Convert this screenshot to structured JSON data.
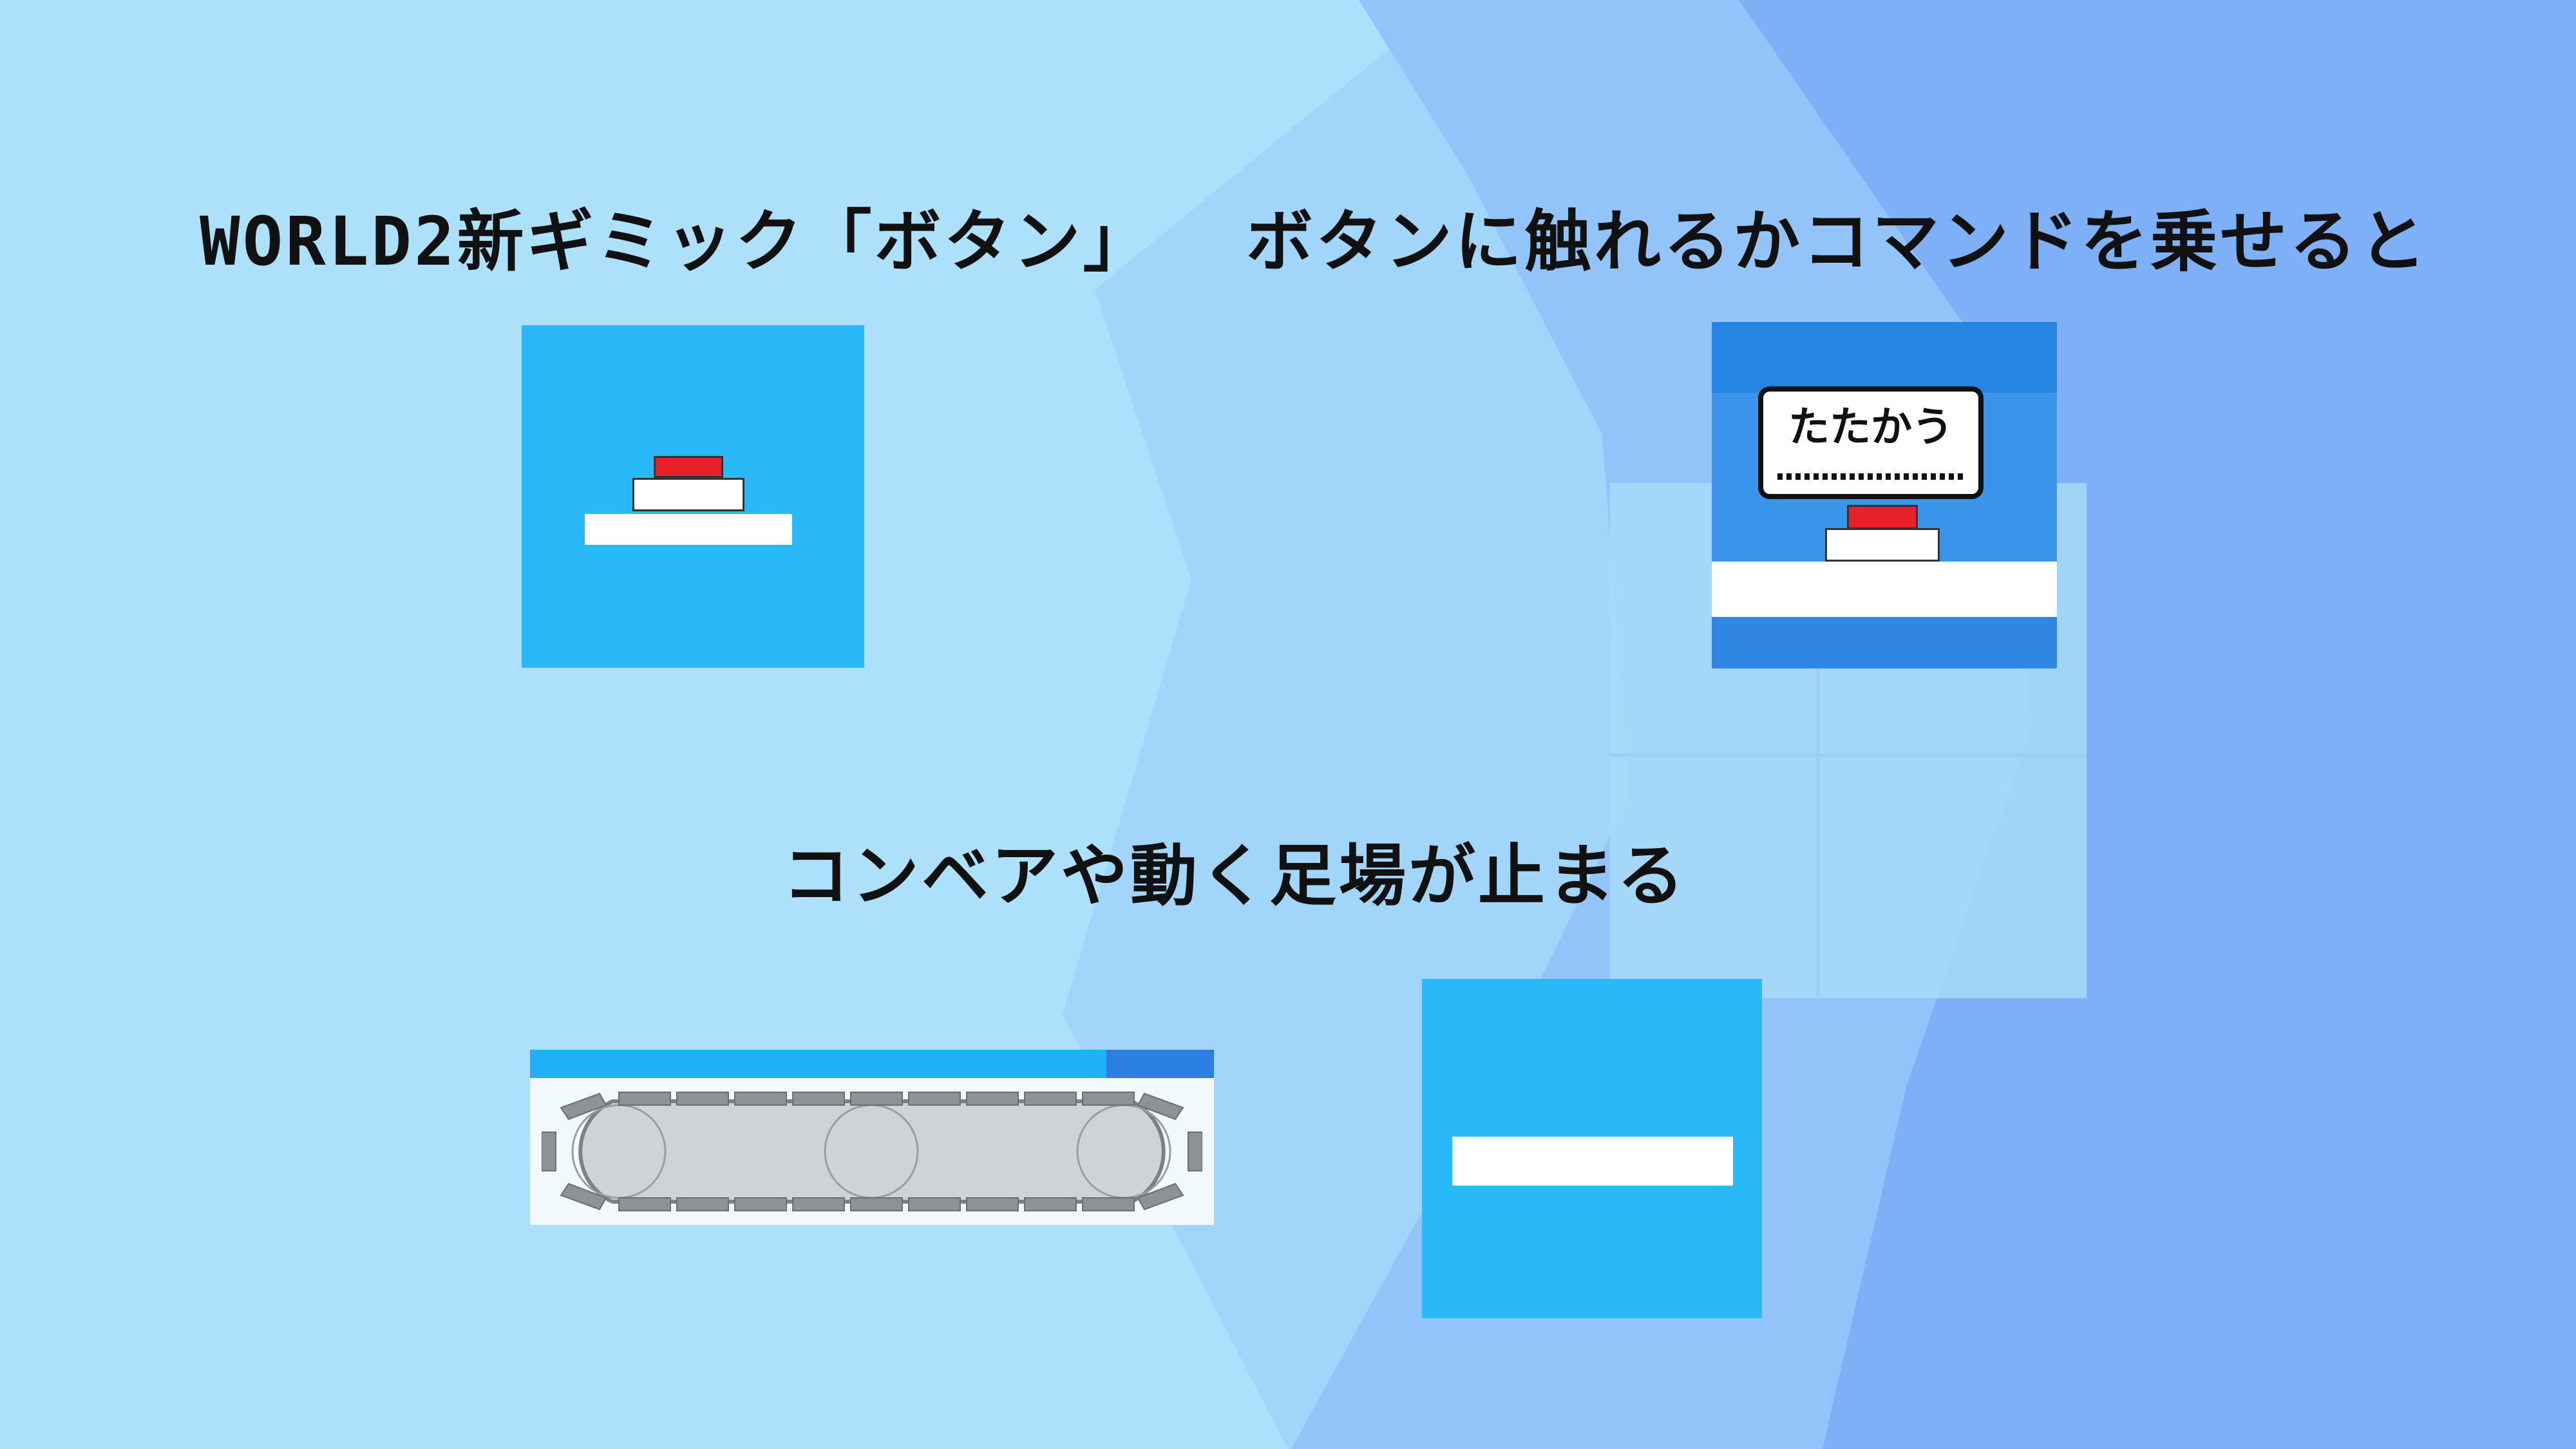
{
  "captions": {
    "line1": "WORLD2新ギミック「ボタン」",
    "line2": "ボタンに触れるかコマンドを乗せると",
    "line3": "コンベアや動く足場が止まる"
  },
  "command_tile": {
    "command_label": "たたかう"
  },
  "colors": {
    "sky_light": "#ace0fb",
    "sky_mid": "#a2d5fa",
    "sky_right": "#92c3f9",
    "sky_far": "#7eb0f7",
    "tile_blue": "#29b8f8",
    "tile_dark_blue": "#3a95ea",
    "button_red": "#e8202a",
    "platform_white": "#ffffff",
    "conveyor_gray": "#cfd3d6",
    "caption_text": "#111111"
  },
  "icons": {
    "button_tile": "red-button-icon",
    "command_tile": "command-bubble-on-button-icon",
    "conveyor_tile": "conveyor-belt-icon",
    "platform_tile": "moving-platform-icon"
  }
}
